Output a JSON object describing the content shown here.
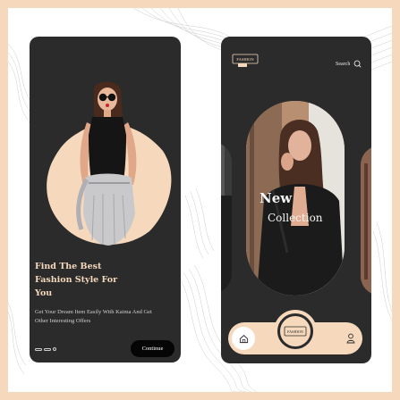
{
  "onboarding": {
    "headline": "Find The Best Fashion Style For You",
    "subtitle": "Get Your Dream Item Easily With Kaima And Get Other Interesting Offers",
    "continue_label": "Continue",
    "page_indicators": 3
  },
  "home": {
    "search_label": "Search",
    "logo_text": "FASHION",
    "collection_title": "New",
    "collection_subtitle": "Collection",
    "badge_text": "FASHION"
  },
  "colors": {
    "background_frame": "#f6d9bd",
    "phone": "#2b2b2b",
    "accent": "#f6d9bd",
    "button": "#050505"
  },
  "icons": [
    "search-icon",
    "home-icon",
    "user-icon",
    "fashion-logo-icon"
  ]
}
